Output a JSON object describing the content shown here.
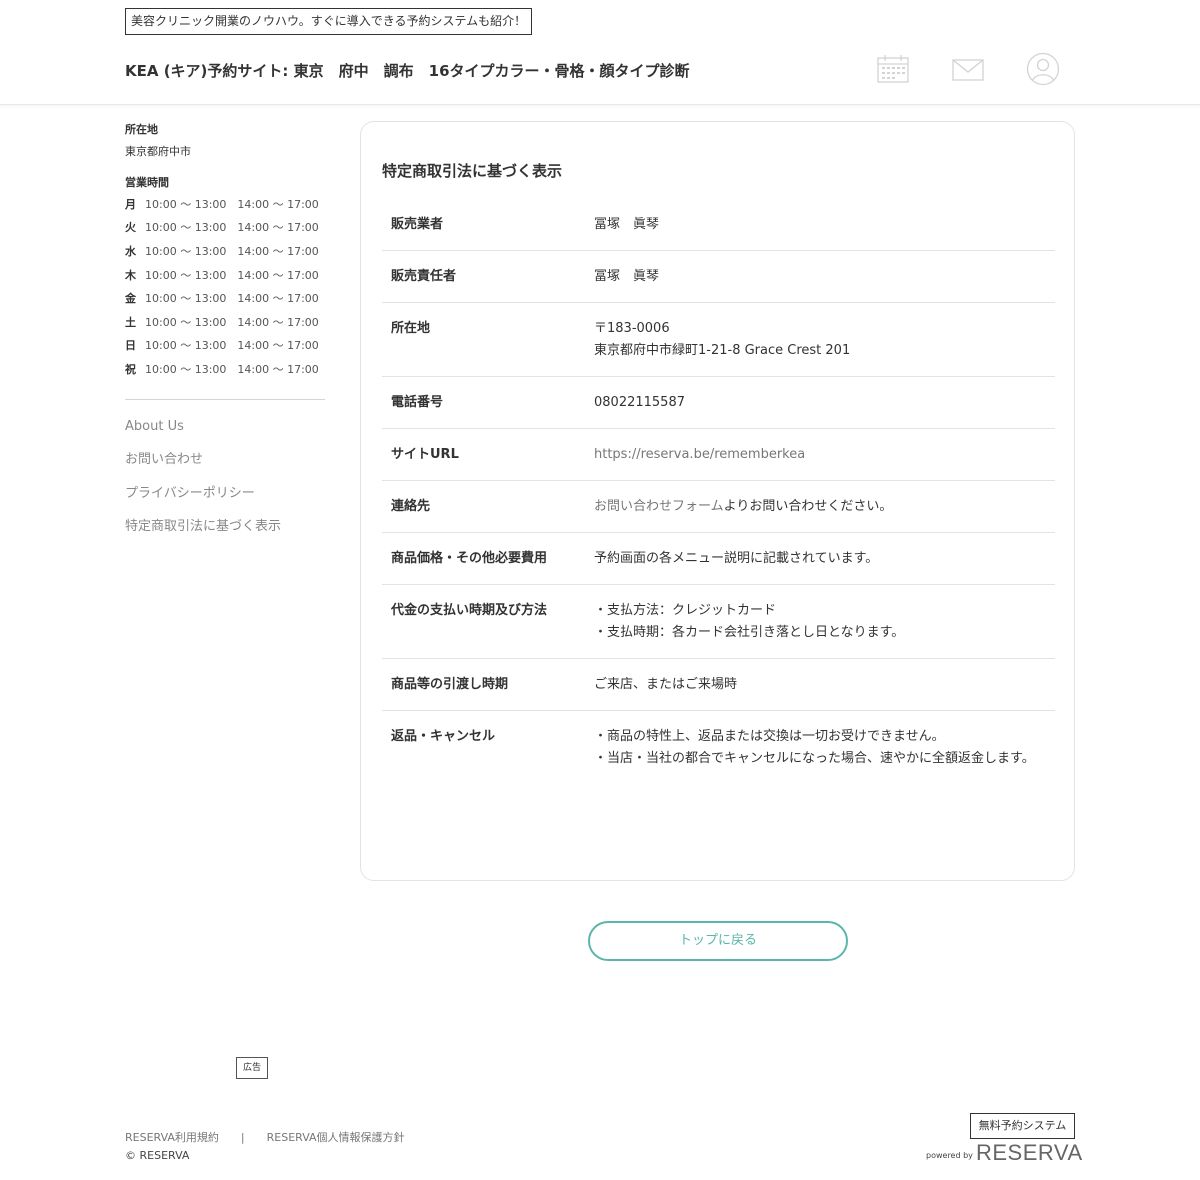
{
  "header": {
    "promo_banner": "美容クリニック開業のノウハウ。すぐに導入できる予約システムも紹介！",
    "site_title": "KEA (キア)予約サイト: 東京　府中　調布　16タイプカラー・骨格・顔タイプ診断",
    "icons": [
      "calendar-icon",
      "mail-icon",
      "user-icon"
    ]
  },
  "sidebar": {
    "location_heading": "所在地",
    "location_value": "東京都府中市",
    "hours_heading": "営業時間",
    "hours": [
      {
        "day": "月",
        "time": "10:00 〜 13:00　14:00 〜 17:00"
      },
      {
        "day": "火",
        "time": "10:00 〜 13:00　14:00 〜 17:00"
      },
      {
        "day": "水",
        "time": "10:00 〜 13:00　14:00 〜 17:00"
      },
      {
        "day": "木",
        "time": "10:00 〜 13:00　14:00 〜 17:00"
      },
      {
        "day": "金",
        "time": "10:00 〜 13:00　14:00 〜 17:00"
      },
      {
        "day": "土",
        "time": "10:00 〜 13:00　14:00 〜 17:00"
      },
      {
        "day": "日",
        "time": "10:00 〜 13:00　14:00 〜 17:00"
      },
      {
        "day": "祝",
        "time": "10:00 〜 13:00　14:00 〜 17:00"
      }
    ],
    "links": [
      "About Us",
      "お問い合わせ",
      "プライバシーポリシー",
      "特定商取引法に基づく表示"
    ]
  },
  "main": {
    "title": "特定商取引法に基づく表示",
    "rows": [
      {
        "label": "販売業者",
        "lines": [
          "冨塚　眞琴"
        ]
      },
      {
        "label": "販売責任者",
        "lines": [
          "冨塚　眞琴"
        ]
      },
      {
        "label": "所在地",
        "lines": [
          "〒183-0006",
          "東京都府中市緑町1-21-8 Grace Crest 201"
        ]
      },
      {
        "label": "電話番号",
        "lines": [
          "08022115587"
        ]
      },
      {
        "label": "サイトURL",
        "lines": [
          "https://reserva.be/rememberkea"
        ]
      },
      {
        "label": "連絡先",
        "link_text": "お問い合わせフォーム",
        "after_link": "よりお問い合わせください。"
      },
      {
        "label": "商品価格・その他必要費用",
        "lines": [
          "予約画面の各メニュー説明に記載されています。"
        ]
      },
      {
        "label": "代金の支払い時期及び方法",
        "lines": [
          "・支払方法：クレジットカード",
          "・支払時期：各カード会社引き落とし日となります。"
        ]
      },
      {
        "label": "商品等の引渡し時期",
        "lines": [
          "ご来店、またはご来場時"
        ]
      },
      {
        "label": "返品・キャンセル",
        "lines": [
          "・商品の特性上、返品または交換は一切お受けできません。",
          "・当店・当社の都合でキャンセルになった場合、速やかに全額返金します。"
        ]
      }
    ],
    "back_button": "トップに戻る"
  },
  "ad": {
    "badge": "広告"
  },
  "footer": {
    "terms_link": "RESERVA利用規約",
    "separator": "|",
    "privacy_link": "RESERVA個人情報保護方針",
    "copyright": "© RESERVA",
    "free_system_badge": "無料予約システム",
    "powered_by": "powered by",
    "logo_text": "RESERVA"
  },
  "colors": {
    "accent": "#5bb5ab",
    "border": "#e3e3e3",
    "text": "#333333",
    "muted": "#888888"
  }
}
